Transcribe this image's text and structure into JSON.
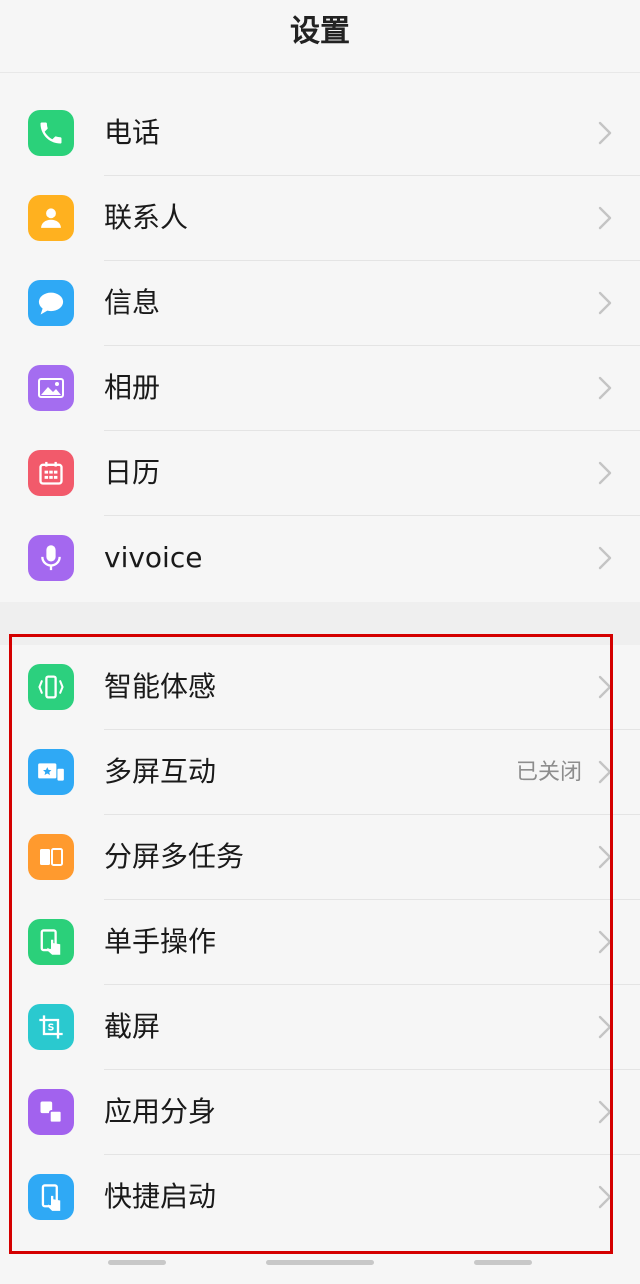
{
  "header": {
    "title": "设置"
  },
  "group1": [
    {
      "label": "电话",
      "icon": "phone-icon",
      "color": "#2bd17a"
    },
    {
      "label": "联系人",
      "icon": "contacts-icon",
      "color": "#ffb11f"
    },
    {
      "label": "信息",
      "icon": "message-icon",
      "color": "#2fa9f5"
    },
    {
      "label": "相册",
      "icon": "gallery-icon",
      "color": "#a46df0"
    },
    {
      "label": "日历",
      "icon": "calendar-icon",
      "color": "#f25a6b"
    },
    {
      "label": "vivoice",
      "icon": "microphone-icon",
      "color": "#a468ef"
    }
  ],
  "group2": [
    {
      "label": "智能体感",
      "icon": "motion-sense-icon",
      "color": "#2cd07e",
      "value": ""
    },
    {
      "label": "多屏互动",
      "icon": "multi-screen-icon",
      "color": "#2fa9f5",
      "value": "已关闭"
    },
    {
      "label": "分屏多任务",
      "icon": "split-screen-icon",
      "color": "#ff9a2e",
      "value": ""
    },
    {
      "label": "单手操作",
      "icon": "one-hand-icon",
      "color": "#2bd07a",
      "value": ""
    },
    {
      "label": "截屏",
      "icon": "screenshot-icon",
      "color": "#2ac9cf",
      "value": ""
    },
    {
      "label": "应用分身",
      "icon": "app-clone-icon",
      "color": "#a262ee",
      "value": ""
    },
    {
      "label": "快捷启动",
      "icon": "quick-launch-icon",
      "color": "#2fa9f5",
      "value": ""
    }
  ],
  "colors": {
    "highlight": "#d40000",
    "chevron": "#c4c4c4",
    "background": "#f6f6f6"
  }
}
